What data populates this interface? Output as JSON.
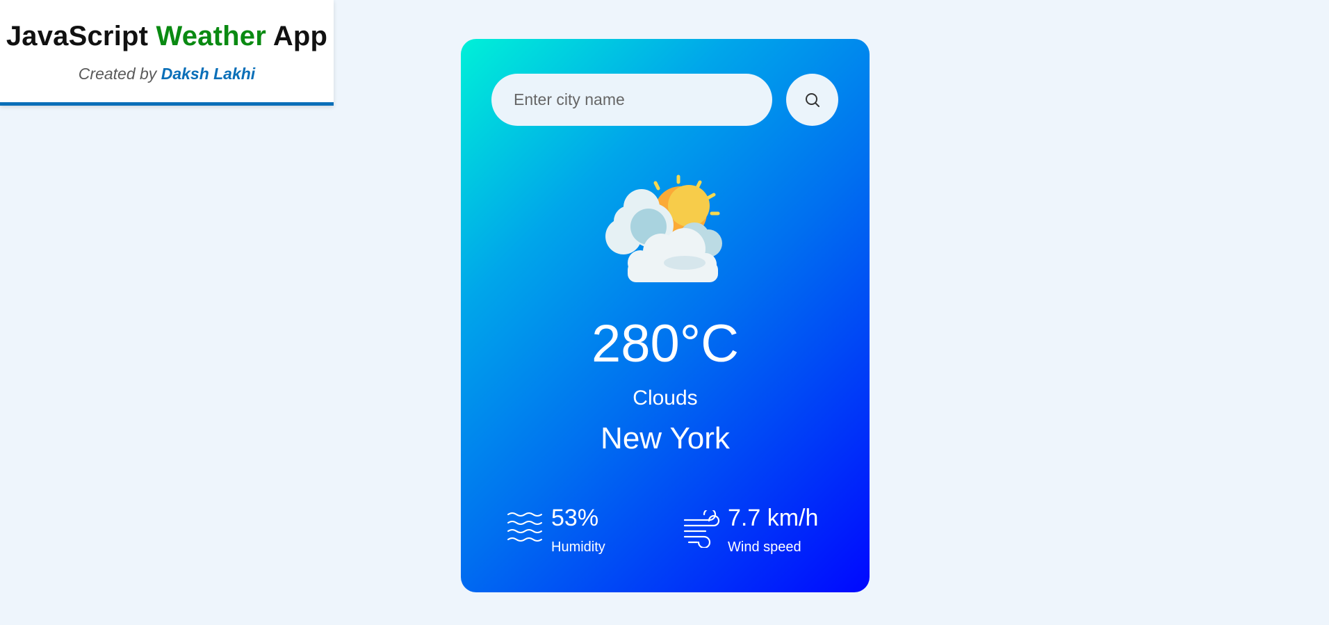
{
  "header": {
    "title_part1": "JavaScript",
    "title_accent": "Weather",
    "title_part2": "App",
    "subtitle_prefix": "Created by",
    "author": "Daksh Lakhi"
  },
  "search": {
    "placeholder": "Enter city name",
    "value": "",
    "button_icon": "search-icon"
  },
  "weather": {
    "icon": "partly-cloudy-sun-icon",
    "temperature": "280°C",
    "condition": "Clouds",
    "city": "New York"
  },
  "details": {
    "humidity": {
      "icon": "humidity-waves-icon",
      "value": "53%",
      "label": "Humidity"
    },
    "wind": {
      "icon": "wind-icon",
      "value": "7.7 km/h",
      "label": "Wind speed"
    }
  },
  "colors": {
    "page_background": "#eef5fc",
    "accent_green": "#0a8a12",
    "accent_blue": "#0a6fb8",
    "card_gradient_start": "#00f0d8",
    "card_gradient_end": "#0008ff"
  }
}
